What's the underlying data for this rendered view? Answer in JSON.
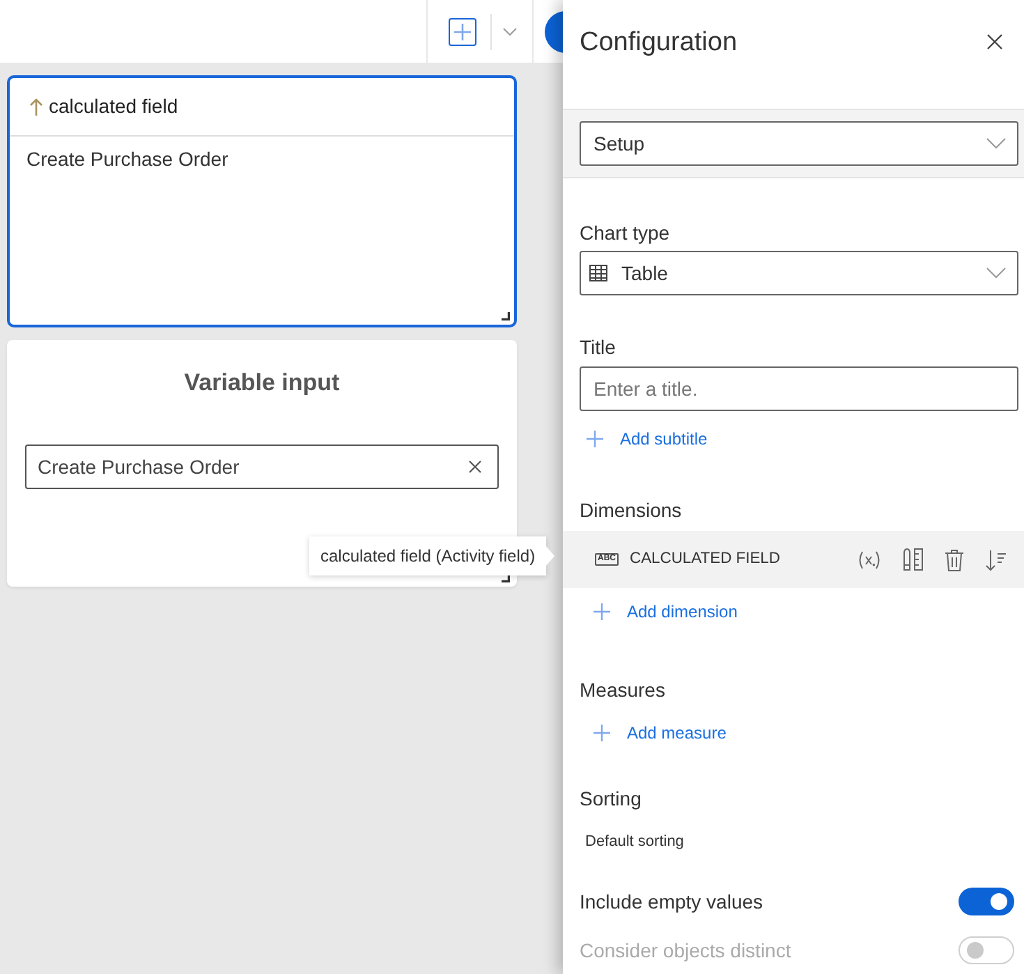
{
  "canvas": {
    "cards": [
      {
        "kind": "table",
        "selected": true,
        "column": {
          "label": "calculated field",
          "sorted_ascending": true
        },
        "rows": [
          "Create Purchase Order"
        ]
      },
      {
        "kind": "variable_input",
        "selected": false,
        "title": "Variable input",
        "value": "Create Purchase Order"
      }
    ]
  },
  "tooltip": {
    "text": "calculated field (Activity field)"
  },
  "panel": {
    "title": "Configuration",
    "view": {
      "value": "Setup"
    },
    "chart_type": {
      "label": "Chart type",
      "value": "Table"
    },
    "title_field": {
      "label": "Title",
      "placeholder": "Enter a title.",
      "add": "Add subtitle"
    },
    "dimensions": {
      "label": "Dimensions",
      "items": [
        {
          "type_tag": "ABC",
          "name": "CALCULATED FIELD",
          "highlighted": true
        }
      ],
      "add": "Add dimension"
    },
    "measures": {
      "label": "Measures",
      "add": "Add measure"
    },
    "sorting": {
      "label": "Sorting",
      "value": "Default sorting"
    },
    "toggles": [
      {
        "label": "Include empty values",
        "on": true,
        "disabled": false
      },
      {
        "label": "Consider objects distinct",
        "on": false,
        "disabled": true
      }
    ]
  }
}
